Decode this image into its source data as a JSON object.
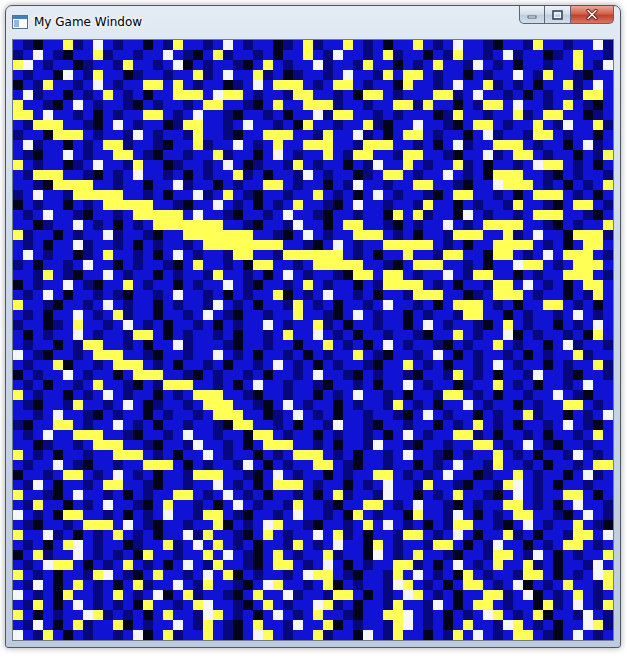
{
  "window": {
    "title": "My Game Window"
  },
  "board": {
    "palette": {
      "b": "#1012d4",
      "d": "#07077e",
      "k": "#03031c",
      "y": "#ffff55",
      "w": "#f6f6f6"
    },
    "rows": [
      "bdkbbydbwbdbbkbdybbdbwbdbbkdbydbbybdbkbbybdbwbbdkbbdybbdbbwd",
      "dbwbdkbbydbbdbbwbdkbydbbdbkbbybdwbbdbydbbkbdybbdbwdbbkdbybbd",
      "ywbdbbkdbbdybbdbwkbdbbdkbybdbbwdbbdybbkbdbybbdwbdbkbbdbbybdw",
      "bdbbkwbdybbkdbbdbbydbwbbydbkdbbdbwbbdybyybdbbkbdbbwbdybbdkbb",
      "kbdybbdbwbdbbyybybdbbkdbwbyyybdbyybdbbkybbdbwbbydbdbkbbydbwb",
      "bwdbbkbdbybdbkbbyyybwyybdbbdyybbdbkyybdbbbyydbwbbdbkbdbbdyyb",
      "ybbdkbwbdbbdkbdbbdbyybbdkbybbyyydbbdbbyydybbkbdyybwbbdbybdkb",
      "yybwbbdbkbdbbyybdbwbbdkbbdbkbbwdyybbdbdbbbkdybbdbbydbyybbkdb",
      "bdyyybbdkbwbdbbkdyybbdbwbbdbkybbdbbydkbbwbbdkbyybdbbybdwbbyd",
      "dbbkyyybdbbdwbdbbdybbdkbbyyybbdybbwdbkbyybdbbkbwdbbdyybdbbkb",
      "bwdbbkbdbyydbbdkbbydbbwbdbybbyyybbdyyybbdbkbwdbbyyybdbbkbwdb",
      "bdkbbwbdbbyybdkbbdbbydbbkbwbdbbybdyybbdyybbdkbbwdbyybdbbkbdy",
      "ybdbbkdbwbbdybbkdbbdbwbkdbbdybdbbkbdwbbybdbbydbkbbdbwyybdbkb",
      "bdyyybbdkbdbwbbdbkbdbbydbkbbdwbdbbkdbyybdbbwbdbkyyybbdkbdbbd",
      "bbdkyyyybbdbbkbbwdbbkbdbbyybdbbkbdwbbdbbyybbdkbbwyyybdbkbdby",
      "dbwbbdyyyyybbdbkbbwdbybdkbbdbbybdbkbwbdbbdkbyybbdbkbyyybdbkb",
      "kbdbbkbdbyyyyybbdkbbwbdbkbdbybbdkbwbbdbbdybbkbdbbdybbdkbyybd",
      "bdbwbbdkbbdbyyyyybwbbdkbbdbwbbdkbbdbbkybydbbkwbdbbdbyyybbdkb",
      "bbkdbbwbdbkbdbyyyyyyybbdkbbdwbbkbyybbdkbdbbwbdbyyyybbdkbdbby",
      "ydbbkbdbbwdbbdkbbyyyyyyybbdkbwbdbbyyybdbkbbdyyybbydbwbbkyyyd",
      "bdbkbbwdbbdbkbdbbdbyyyyyyyybbdkbwbdbbyyyyybdbkbbyyyybdbkbyyb",
      "bwbdbbkdbybbdbkbwbdbbdyybbdyyyyyybdbkbbybbdyybbkyybdbwbyyybd",
      "dbkbbdbwbbkbdbbdkbybbdbkyybbdbyyyyybbdkbyyybbdbkbbwyybdbyyyb",
      "bbdybdkbbwbdbbkbdbbdybbdbkbwbdbbdkyybyybdbbwbdyybbkbdbbyyybd",
      "kbdbbwbdkbbybdbbkbdbbwbdkbbdbybdbbkbdyyyybdbkbbdyybwbdbkbyyb",
      "bdbwbkbbdbdkbbdbwbbdbkbdbbykbdbwbbdbkbbdyyybbkdbyyybdbbkbdyb",
      "ybbdkbbdbwbdbbkbdbbdwbdbkbbdybdbkbbdbwbbdbkbyyybdbkbbyybdbkb",
      "bdbkbbwbdbydbbkbbdbwbdkbbdbbybbdkbwbdbbkbdbbdyybbkbdbbdbwbdb",
      "dbbkdbybbdbwbdbkbbdbkbdbbwbdbbydbkbbdbbkbwbdbbdkbybdbbkbdbwb",
      "bkbdbbwbdbbdyybkbdbbdbkbbdbybbwbdbkbbdbbdkbbybdbbwkbdbbdbkyb",
      "bdbbkbdyybbdbkbbwdbbbdkbbdbbkbbybdbkbwbdbbdkbdbbybdbbkbwdbbd",
      "wbdkbbdbyyybbdkbbdbbwbdbkbbdbkbdbbybdkbbdbwbkbdbbdbkbdbbydbb",
      "bdbbykbbdbyyybdbkbbdbkbbdbwbdbkbdbbdkbbybdbkbbdbwbdbbkbdbbyd",
      "kbdbbwbdbbkbyyybbdkbdbbdbkbbdbwbbdkbdbbdkbbdybdbkbbdwbbdkbbd",
      "bdbkbbdbybbdkbdyyybbdbkbwbbdbbdkbbdbkbbwbdbbkdbbybdbkbbdbwbb",
      "ybdbbkbdbwbdbbkbdbyyybbdkbbdbbkbdbwbbdbkbbdyybdbkbbdbbwbdkbb",
      "bdkbbdybbdbwbkdbbdbyyybbdkbwbdbbkbdbbdybdbkbbwbdbbkbdbbyybdb",
      "bbdbwbbdkbdbbkbdbbdbyyybbkdbwbdbkbbdbbdkbwbdbbkbdbbydbbkbdbw",
      "dkbbyybdbbwbdbkbbdbbdkyybbdbkbbdwbbdkbbdbbkbdbybdbkbbdbwbdkb",
      "bdbwbbyyybbdkbbdbwbbdbbkyybdbbkbdbbdbkbwbdbbyydbkbbdbkbbdbyb",
      "bbkdbbdbyyybbdkbbdwbbdbkbyyybbdbkbbdwbbdkbbdbbyybdbwbdkbbdbb",
      "ybdbkbbdbbyyybdbkbbwbdbbkbdbyyybdbkbbdbwbbdkbdbbybdbkbbdwbdb",
      "bdbbwbdkbbdbbyyybkbdbbdwbkbdbbyybdkbbdbbkbdbwbbdybbdbkbbdbyy",
      "kbbdbyybdbwbdbkbbdyyybbdkbwbdbbkbdbbyybdbdbwbbkdbbybdbbkbwdb",
      "bdwbkbbdbyybbdkbbdbbwbdbkbyyybdbbkbdbwbbdybbdkbbdywbdbkbbdbb",
      "ybbdkbwbbdbkbdbbyybdbwbdbkbbdbkbydbbdwbbkbdbybbdkbwbdbbyybkb",
      "bdybbkbdbwbbdkbybbdbkbwbdbbdybbdkbbyybdbwbbdkbdbbyybdbkbwbbd",
      "wbdbkyybbdbkbdbwbbdyybdkbbdbwbbdbkybdbbkybbdwbkbdbyybbdkbwbd",
      "bdkbbdbyyybwbdkbbdbbykbdbwybbdkbbdbybwbdbkbdyybbdkbwbdbbybdk",
      "ybbwdbkbdbybdbkbbwdybbdkbybdbbwbydbkbbdyybdbwbkbbydbkbbdyybw",
      "bdbkbywbdbbkdbbydbwbybdbkbbdybdbwbbkybdbbdyybkbdwbbkbdbyybdb",
      "kbydbbwbdbdbkybbdbbybwbdkbybdbbydbbkwbdbybbdkbbdyybdwbkbdbby",
      "bdbwyybkbdbybdbkbwbdybbdkbyybdbwbkbdbbyydbkbwbdbybbydbkbbdwb",
      "ybdbkbbdywbdkbybbdbwbykbdbbdbwyybdkbbdybwbdbkybdbbdyybkbdbwy",
      "bdwbkbybdbkbydbbwbdybbdkbwybbdbykbdbbdwybdbkbyybdbwkbdbybbdy",
      "wbdbkybbdbybdbwkbydbbdkbybbwdbbdyybkbdbwybdbkbbyydbwkbdbybdb",
      "bdybkbwbdbdbkybbdbywbbdkbybdbbwydbkbbdybbdwbkbyybdbbkydbwbdy",
      "ybkbdbbwydbdbkbybbdwybdbkbwbdbybbdkbbyywbdbkbdbwybdbykbbdwbd",
      "bdwbkbydbbykbdbbwbdybdkbybbdwbbykbdbbdywbdbkbybbdwybdbkbbwyd",
      "wbdybkbdbbdbwkbydbbybdkbwybdbbydbbkwbdybbkbdybwbdbyybdkbwbdb"
    ]
  }
}
